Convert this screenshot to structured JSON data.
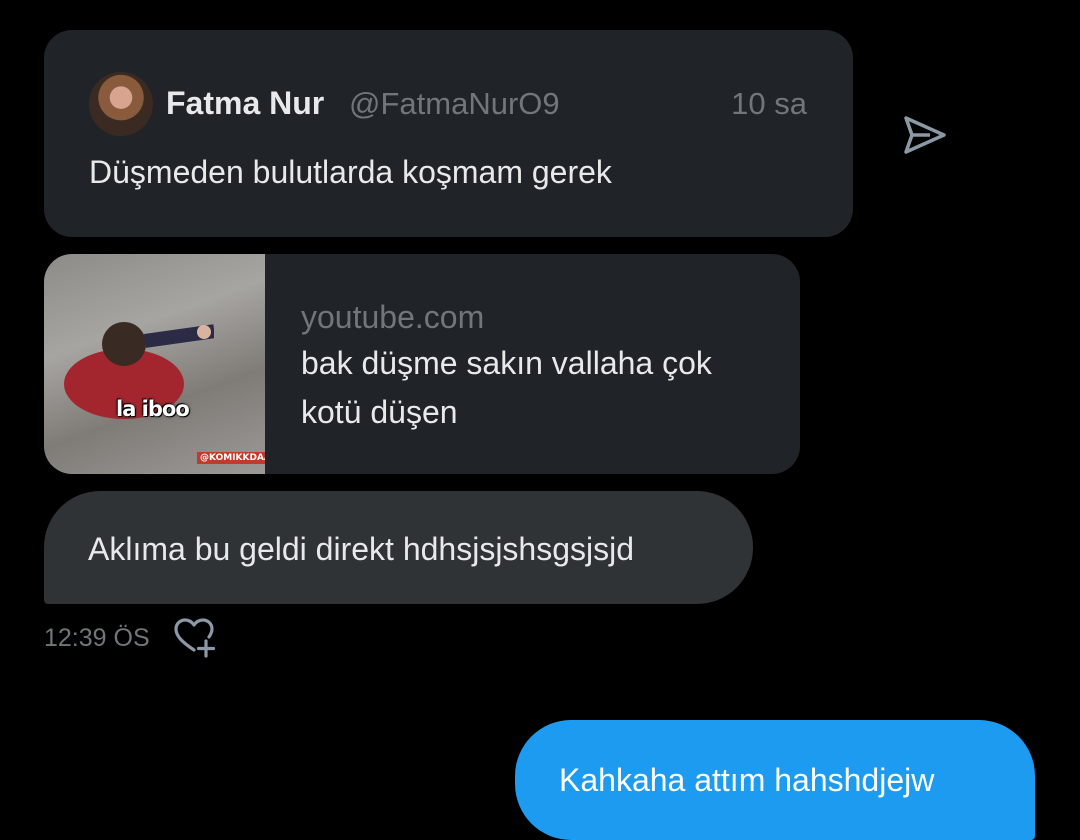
{
  "quoted_tweet": {
    "author_name": "Fatma Nur",
    "author_handle": "@FatmaNurO9",
    "time": "10 sa",
    "text": "Düşmeden bulutlarda koşmam gerek"
  },
  "link_card": {
    "domain": "youtube.com",
    "title": "bak düşme sakın vallaha çok kotü düşen",
    "thumbnail_caption": "la iboo",
    "thumbnail_watermark": "@KOMIKKDAA"
  },
  "received_message": {
    "text": "Aklıma bu geldi direkt hdhsjsjshsgsjsjd",
    "time": "12:39 ÖS"
  },
  "sent_message": {
    "text": "Kahkaha attım hahshdjejw"
  },
  "icons": {
    "share": "send-arrow-icon",
    "reaction": "heart-plus-icon",
    "avatar": "profile-photo"
  },
  "colors": {
    "background": "#000000",
    "card": "#202327",
    "bubble_received": "#2f3336",
    "bubble_sent": "#1d9bf0",
    "secondary_text": "#71767b"
  }
}
